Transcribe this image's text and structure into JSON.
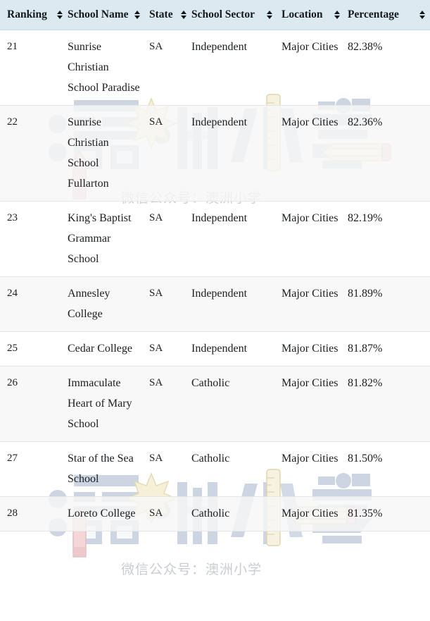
{
  "table": {
    "columns": [
      {
        "label": "Ranking",
        "sort": "sort-icon"
      },
      {
        "label": "School Name",
        "sort": "sort-icon"
      },
      {
        "label": "State",
        "sort": "sort-icon"
      },
      {
        "label": "School Sector",
        "sort": "sort-icon"
      },
      {
        "label": "Location",
        "sort": "sort-icon"
      },
      {
        "label": "Percentage",
        "sort": "sort-icon"
      }
    ],
    "rows": [
      {
        "ranking": "21",
        "school_name": "Sunrise Christian School Paradise",
        "state": "SA",
        "school_sector": "Independent",
        "location": "Major Cities",
        "percentage": "82.38%"
      },
      {
        "ranking": "22",
        "school_name": "Sunrise Christian School Fullarton",
        "state": "SA",
        "school_sector": "Independent",
        "location": "Major Cities",
        "percentage": "82.36%"
      },
      {
        "ranking": "23",
        "school_name": "King's Baptist Grammar School",
        "state": "SA",
        "school_sector": "Independent",
        "location": "Major Cities",
        "percentage": "82.19%"
      },
      {
        "ranking": "24",
        "school_name": "Annesley College",
        "state": "SA",
        "school_sector": "Independent",
        "location": "Major Cities",
        "percentage": "81.89%"
      },
      {
        "ranking": "25",
        "school_name": "Cedar College",
        "state": "SA",
        "school_sector": "Independent",
        "location": "Major Cities",
        "percentage": "81.87%"
      },
      {
        "ranking": "26",
        "school_name": "Immaculate Heart of Mary School",
        "state": "SA",
        "school_sector": "Catholic",
        "location": "Major Cities",
        "percentage": "81.82%"
      },
      {
        "ranking": "27",
        "school_name": "Star of the Sea School",
        "state": "SA",
        "school_sector": "Catholic",
        "location": "Major Cities",
        "percentage": "81.50%"
      },
      {
        "ranking": "28",
        "school_name": "Loreto College",
        "state": "SA",
        "school_sector": "Catholic",
        "location": "Major Cities",
        "percentage": "81.35%"
      }
    ]
  },
  "watermark": {
    "caption_1": "微信公众号：澳洲小学",
    "caption_2": "微信公众号：澳洲小学",
    "logo_text": "澳洲小学",
    "icons": [
      "star-icon",
      "ruler-icon",
      "pencil-icon"
    ]
  },
  "colors": {
    "header_bg": "#dbe9f1",
    "header_border": "#c7dbe6",
    "row_stripe": "#f6f6f6",
    "row_border": "#e6e6e6",
    "text": "#1b1e21",
    "watermark_glyph": "#aebcd0",
    "watermark_text": "#c9cdd2",
    "star_fill": "#f6efd6",
    "pencil_body": "#f5f0df",
    "pencil_eraser": "#f2cfd2"
  }
}
